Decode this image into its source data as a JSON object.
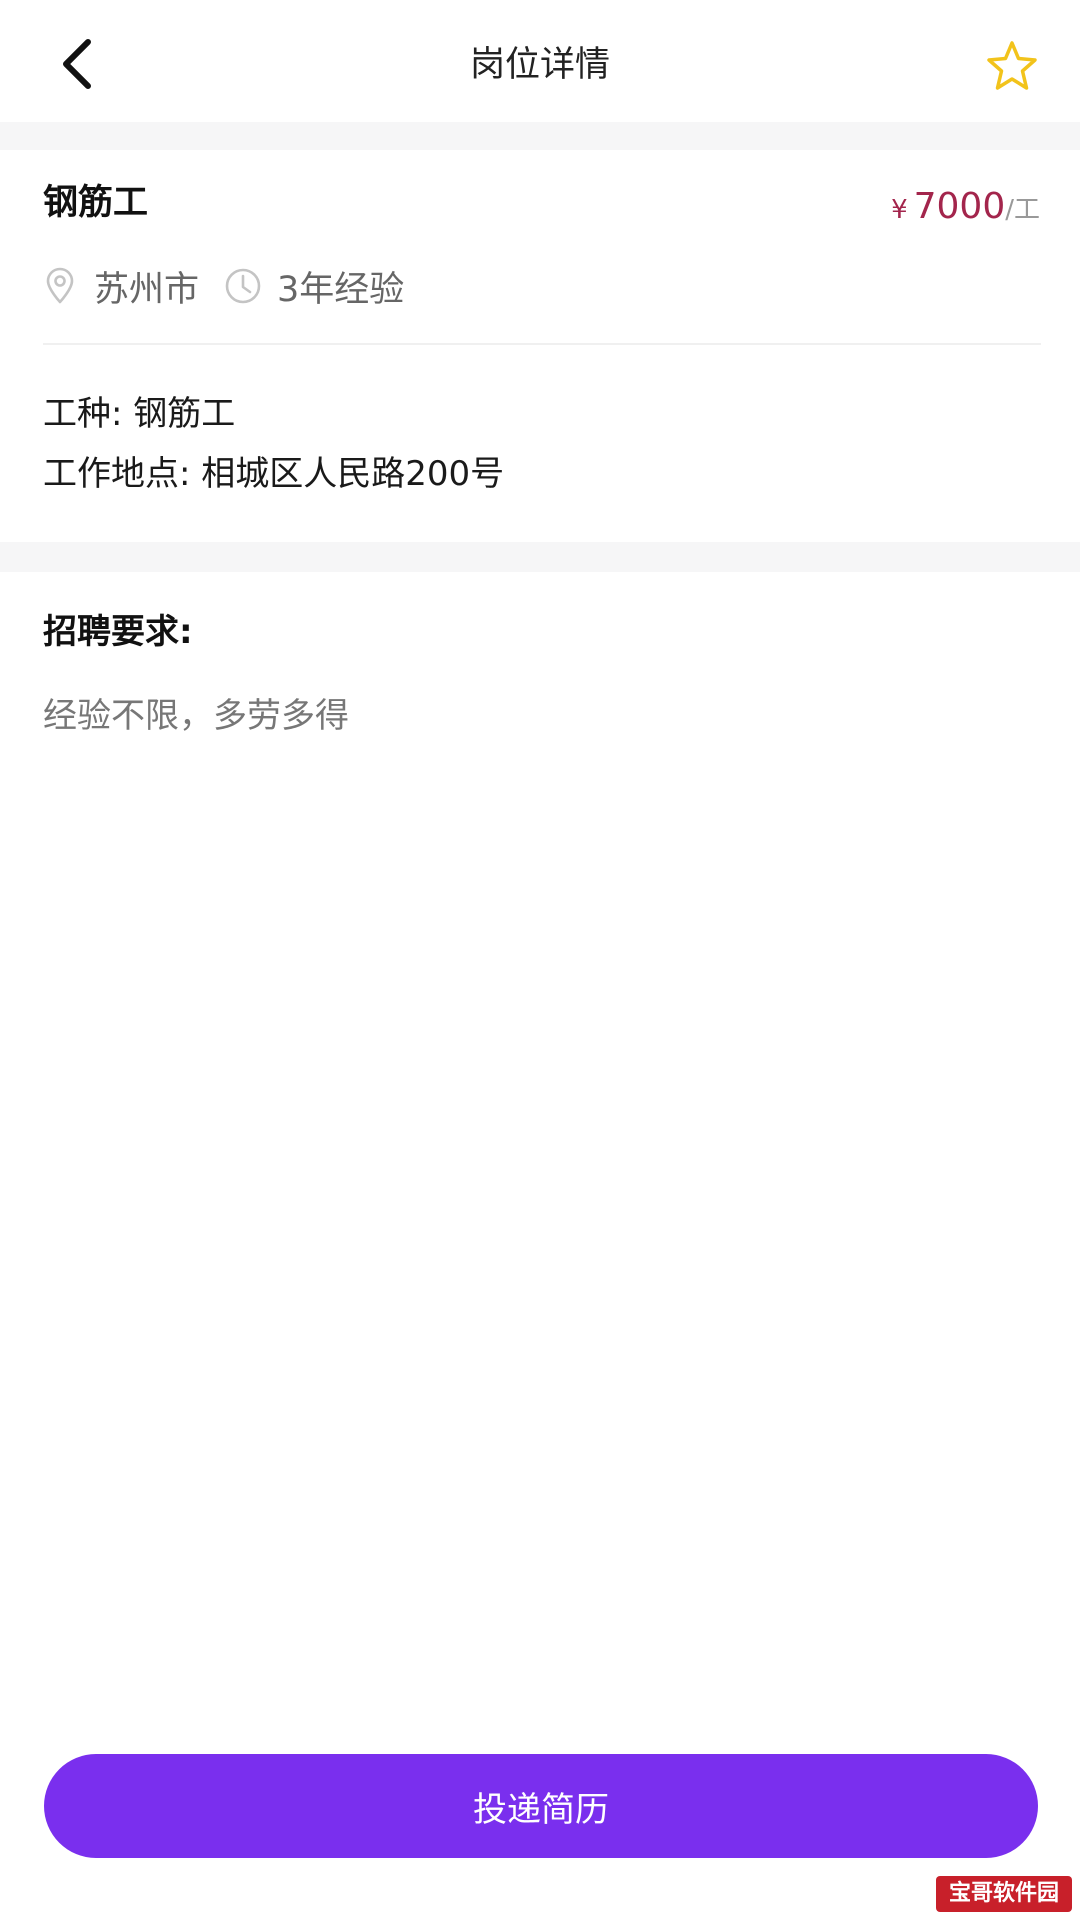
{
  "header": {
    "title": "岗位详情",
    "back_icon": "chevron-left-icon",
    "favorite_icon": "star-outline-icon"
  },
  "job": {
    "title": "钢筋工",
    "salary_currency": "¥",
    "salary_amount": "7000",
    "salary_unit": "/工",
    "city": "苏州市",
    "experience": "3年经验",
    "trade_label": "工种:",
    "trade_value": "钢筋工",
    "location_label": "工作地点:",
    "location_value": "相城区人民路200号"
  },
  "requirements": {
    "title": "招聘要求:",
    "text": "经验不限，多劳多得"
  },
  "actions": {
    "apply_label": "投递简历"
  },
  "watermark": {
    "text": "宝哥软件园"
  },
  "colors": {
    "accent": "#7a2fee",
    "salary": "#a3254c",
    "star": "#f2c31b"
  }
}
